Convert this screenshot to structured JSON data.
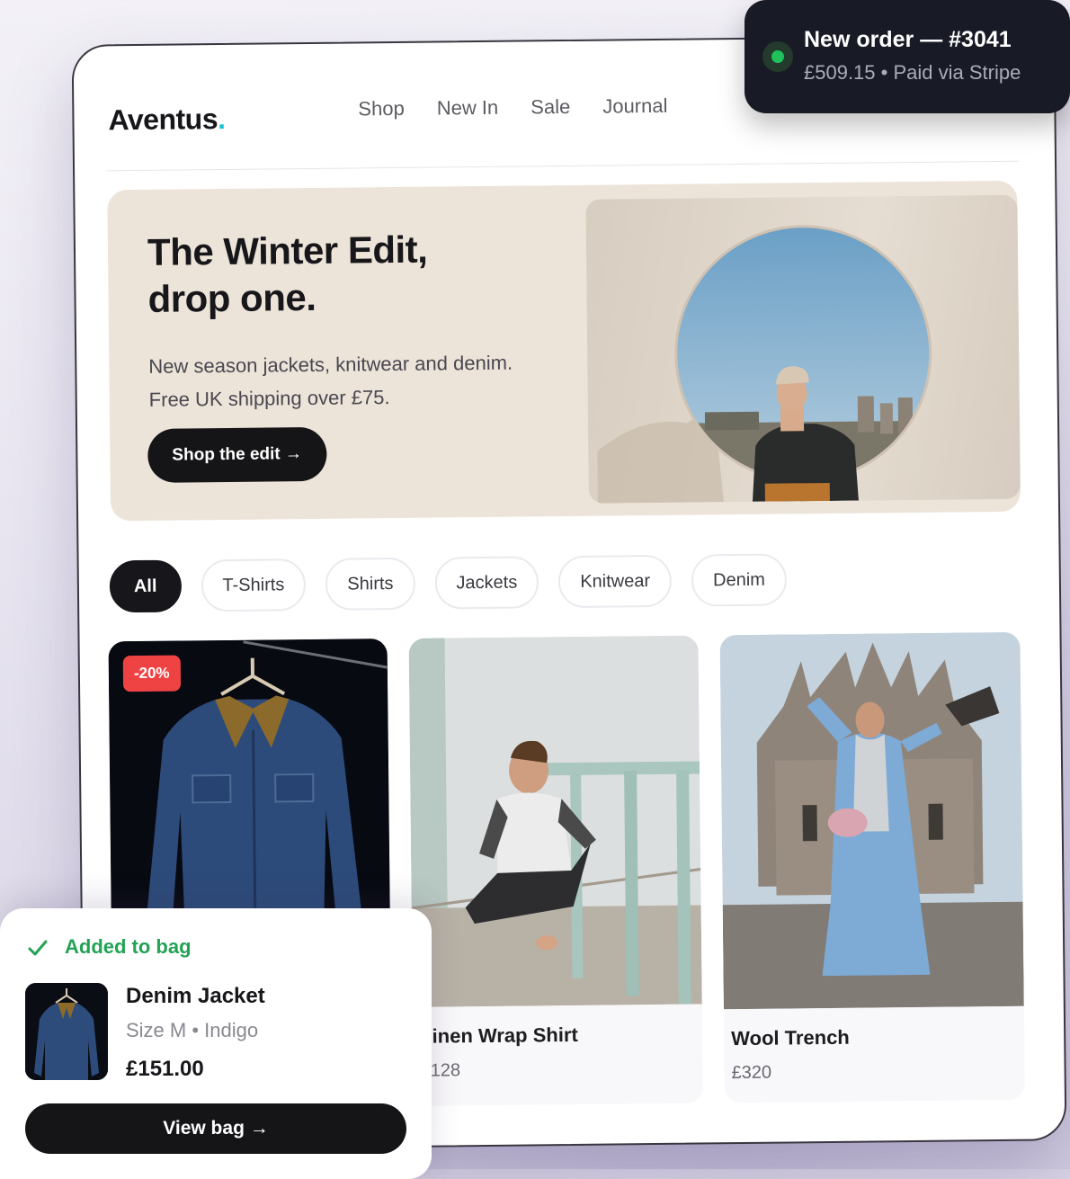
{
  "brand": {
    "name": "Aventus",
    "dot": ".",
    "accent": "#19c2d6"
  },
  "nav": [
    {
      "label": "Shop"
    },
    {
      "label": "New In"
    },
    {
      "label": "Sale"
    },
    {
      "label": "Journal"
    }
  ],
  "hero": {
    "title": "The Winter Edit,\ndrop one.",
    "subtitle": "New season jackets, knitwear and denim. Free UK shipping over £75.",
    "cta": "Shop the edit →",
    "image": "man-in-circular-window-photo"
  },
  "filters": {
    "active": "All",
    "chips": [
      "All",
      "T-Shirts",
      "Shirts",
      "Jackets",
      "Knitwear",
      "Denim"
    ]
  },
  "products": [
    {
      "image": "denim-jacket-on-hanger-photo",
      "badge": "-20%"
    },
    {
      "image": "man-sitting-on-pier-photo",
      "name": "Linen Wrap Shirt",
      "price": "£128"
    },
    {
      "image": "woman-in-blue-coat-with-pigeons-photo",
      "name": "Wool Trench",
      "price": "£320"
    }
  ],
  "order_toast": {
    "title": "New order — #3041",
    "detail": "£509.15 • Paid via Stripe",
    "status_color": "#1fc25a"
  },
  "bag_toast": {
    "status": "Added to bag",
    "status_color": "#23a255",
    "item_name": "Denim Jacket",
    "item_meta": "Size M • Indigo",
    "item_price": "£151.00",
    "cta": "View bag →"
  }
}
